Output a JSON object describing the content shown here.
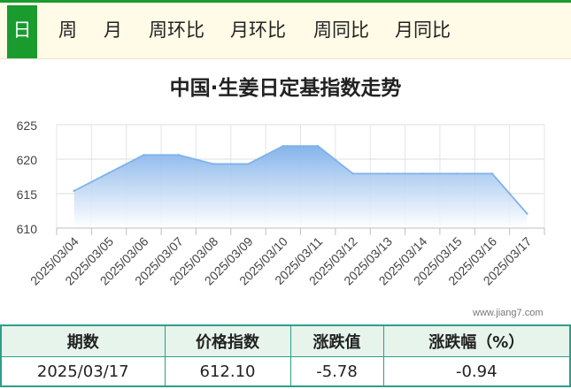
{
  "tabs": [
    {
      "label": "日",
      "active": true
    },
    {
      "label": "周",
      "active": false
    },
    {
      "label": "月",
      "active": false
    },
    {
      "label": "周环比",
      "active": false
    },
    {
      "label": "月环比",
      "active": false
    },
    {
      "label": "周同比",
      "active": false
    },
    {
      "label": "月同比",
      "active": false
    }
  ],
  "accent_color": "#1a9b2e",
  "title": "中国·生姜日定基指数走势",
  "chart_data": {
    "type": "area",
    "title": "中国·生姜日定基指数走势",
    "xlabel": "",
    "ylabel": "",
    "categories": [
      "2025/03/04",
      "2025/03/05",
      "2025/03/06",
      "2025/03/07",
      "2025/03/08",
      "2025/03/09",
      "2025/03/10",
      "2025/03/11",
      "2025/03/12",
      "2025/03/13",
      "2025/03/14",
      "2025/03/15",
      "2025/03/16",
      "2025/03/17"
    ],
    "values": [
      615.4,
      618.0,
      620.6,
      620.6,
      619.3,
      619.3,
      621.9,
      621.9,
      617.9,
      617.9,
      617.9,
      617.9,
      617.9,
      612.1
    ],
    "yticks": [
      610,
      615,
      620,
      625
    ],
    "ylim": [
      610,
      625
    ],
    "grid": true,
    "line_color": "#7fb3e8",
    "fill_color": "#8cbcf0"
  },
  "watermark": "www.jiang7.com",
  "table": {
    "headers": [
      "期数",
      "价格指数",
      "涨跌值",
      "涨跌幅（%）"
    ],
    "row": [
      "2025/03/17",
      "612.10",
      "-5.78",
      "-0.94"
    ]
  }
}
